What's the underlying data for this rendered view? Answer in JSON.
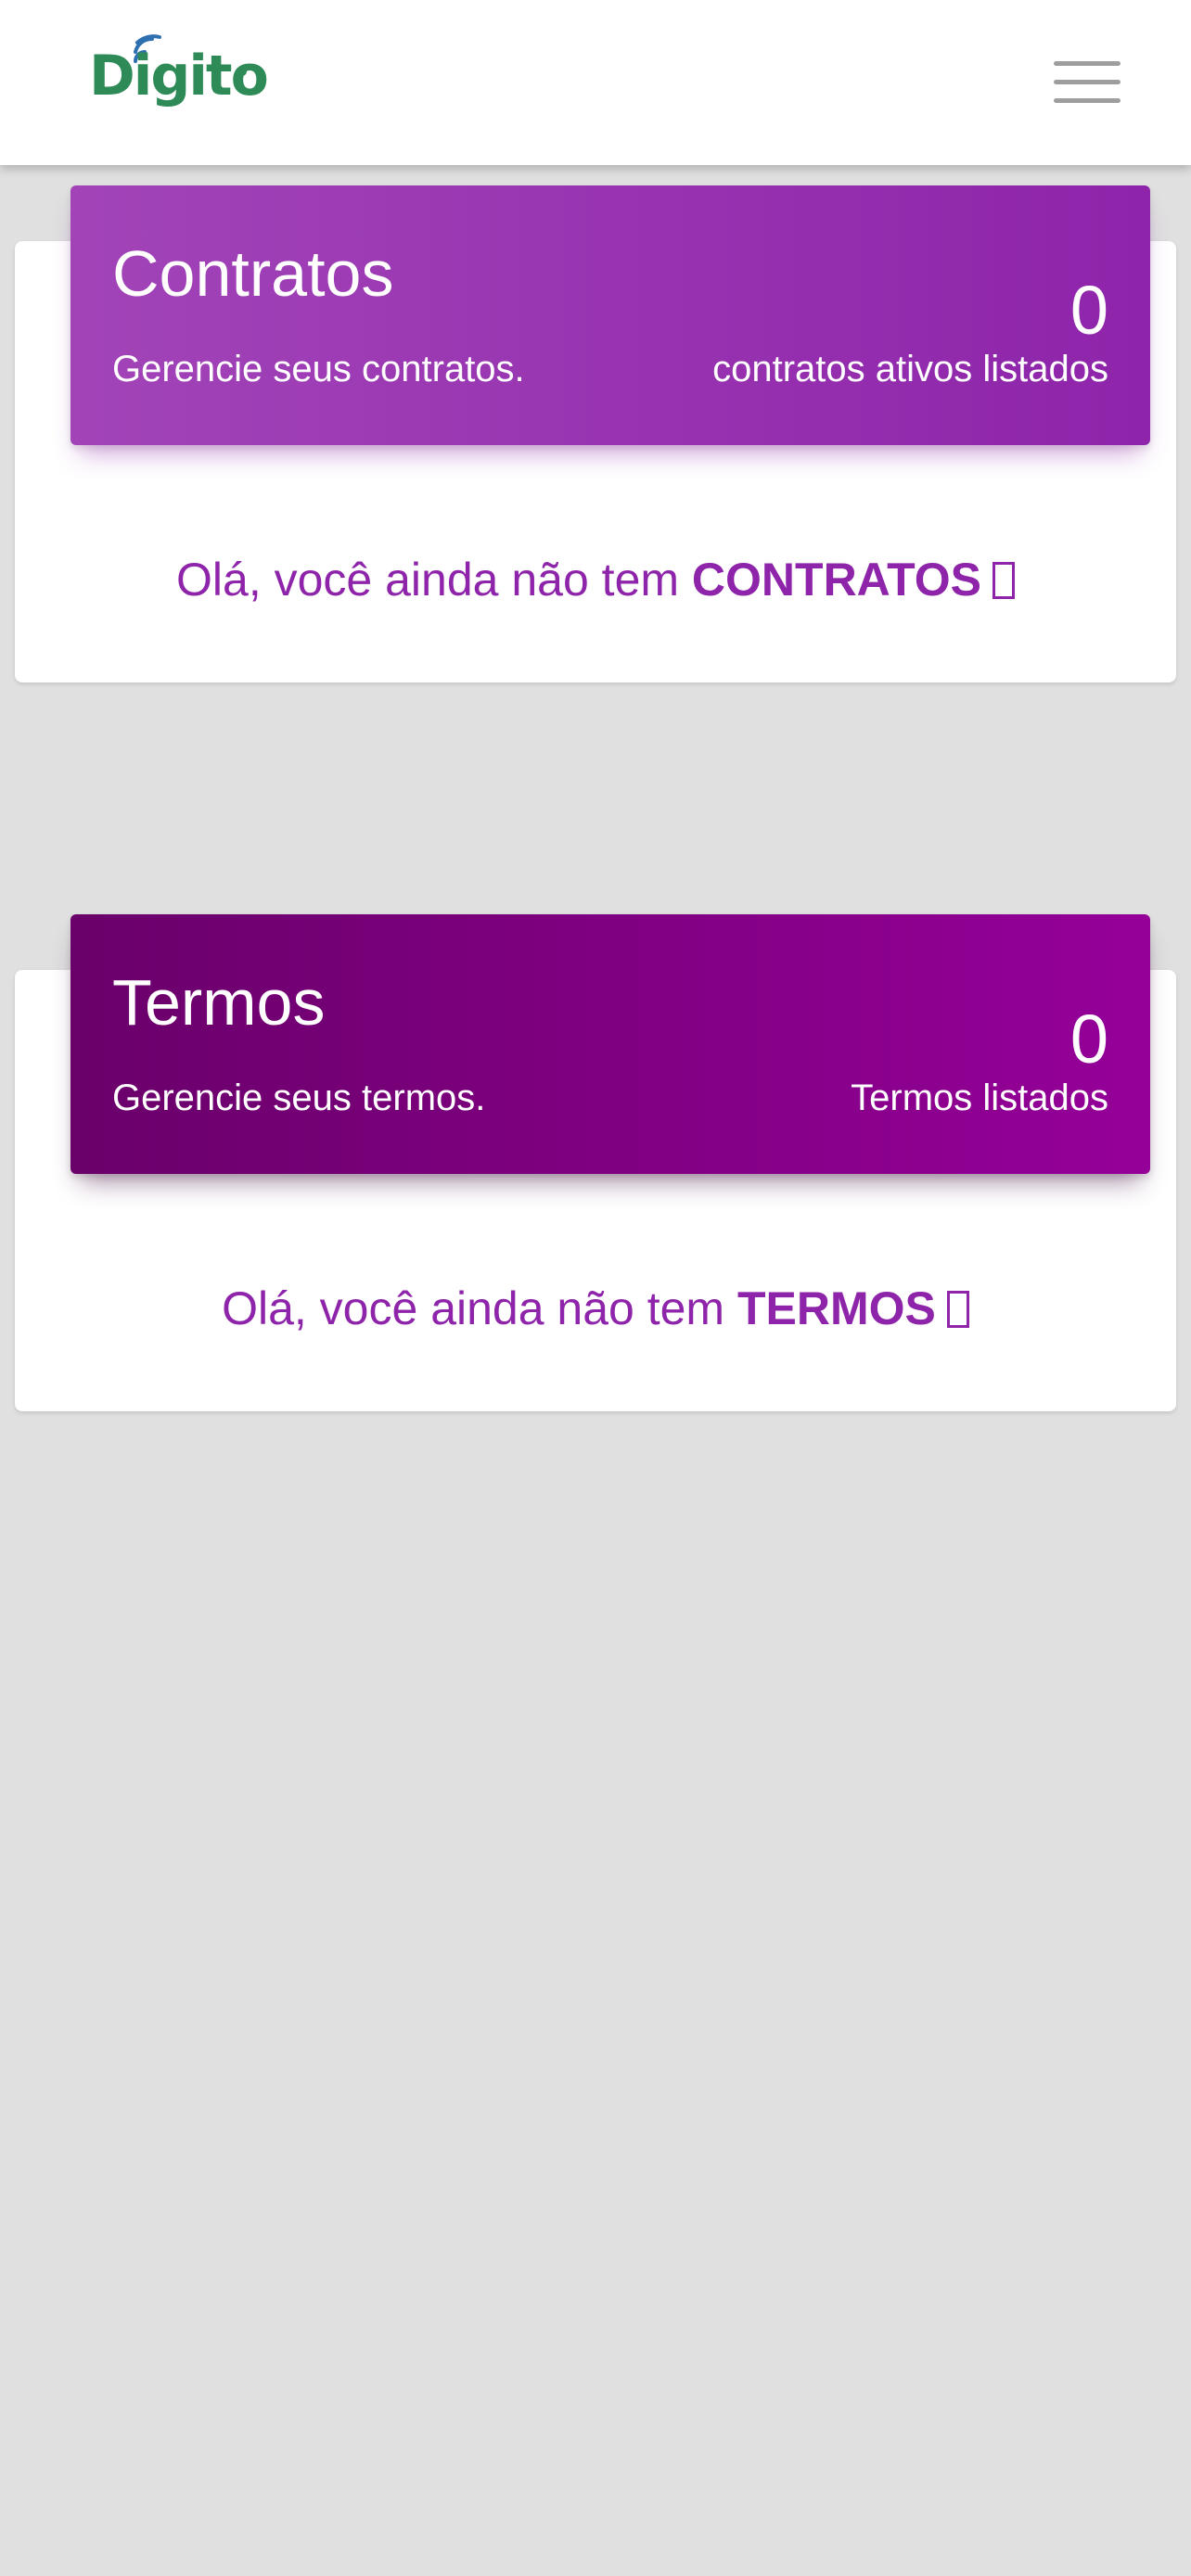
{
  "header": {
    "logo_text": "Digito",
    "menu_icon": "hamburger-menu-icon"
  },
  "colors": {
    "logo_green": "#2e8b57",
    "logo_blue": "#2e6fb0",
    "contratos_header": "#9c3bb3",
    "termos_header": "#7e007f",
    "accent_text": "#8e24aa",
    "page_background": "#e0e0e0"
  },
  "contratos": {
    "title": "Contratos",
    "subtitle": "Gerencie seus contratos.",
    "count": "0",
    "count_label": "contratos ativos listados",
    "empty_prefix": "Olá, você ainda não tem",
    "empty_keyword": "CONTRATOS",
    "empty_icon": "missing-glyph-box-icon"
  },
  "termos": {
    "title": "Termos",
    "subtitle": "Gerencie seus termos.",
    "count": "0",
    "count_label": "Termos listados",
    "empty_prefix": "Olá, você ainda não tem",
    "empty_keyword": "TERMOS",
    "empty_icon": "missing-glyph-box-icon"
  }
}
